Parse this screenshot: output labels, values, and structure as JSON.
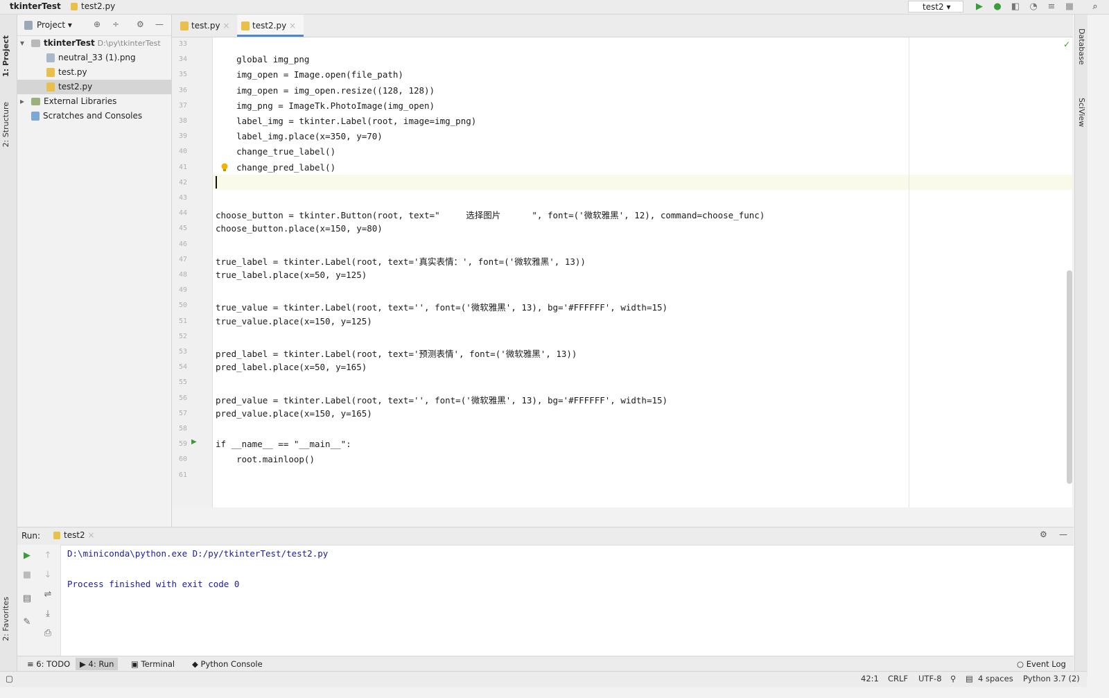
{
  "titlebar": {
    "project": "tkinterTest",
    "file": "test2.py",
    "run_config": "test2"
  },
  "left_strip": {
    "project_tab": "1: Project",
    "structure_tab": "2: Structure",
    "favorites_tab": "2: Favorites"
  },
  "right_strip": {
    "database_tab": "Database",
    "sciview_tab": "SciView"
  },
  "project_panel": {
    "title": "Project",
    "root_name": "tkinterTest",
    "root_path": "D:\\py\\tkinterTest",
    "items": [
      {
        "label": "neutral_33 (1).png"
      },
      {
        "label": "test.py"
      },
      {
        "label": "test2.py"
      },
      {
        "label": "External Libraries"
      },
      {
        "label": "Scratches and Consoles"
      }
    ]
  },
  "editor": {
    "tabs": [
      {
        "label": "test.py"
      },
      {
        "label": "test2.py"
      }
    ],
    "line_numbers": [
      "33",
      "34",
      "35",
      "36",
      "37",
      "38",
      "39",
      "40",
      "41",
      "42",
      "43",
      "44",
      "45",
      "46",
      "47",
      "48",
      "49",
      "50",
      "51",
      "52",
      "53",
      "54",
      "55",
      "56",
      "57",
      "58",
      "59",
      "60",
      "61"
    ],
    "lines": [
      "",
      "    global img_png",
      "    img_open = Image.open(file_path)",
      "    img_open = img_open.resize((128, 128))",
      "    img_png = ImageTk.PhotoImage(img_open)",
      "    label_img = tkinter.Label(root, image=img_png)",
      "    label_img.place(x=350, y=70)",
      "    change_true_label()",
      "    change_pred_label()",
      "",
      "",
      "choose_button = tkinter.Button(root, text=\"     选择图片      \", font=('微软雅黑', 12), command=choose_func)",
      "choose_button.place(x=150, y=80)",
      "",
      "true_label = tkinter.Label(root, text='真实表情：', font=('微软雅黑', 13))",
      "true_label.place(x=50, y=125)",
      "",
      "true_value = tkinter.Label(root, text='', font=('微软雅黑', 13), bg='#FFFFFF', width=15)",
      "true_value.place(x=150, y=125)",
      "",
      "pred_label = tkinter.Label(root, text='预测表情', font=('微软雅黑', 13))",
      "pred_label.place(x=50, y=165)",
      "",
      "pred_value = tkinter.Label(root, text='', font=('微软雅黑', 13), bg='#FFFFFF', width=15)",
      "pred_value.place(x=150, y=165)",
      "",
      "if __name__ == \"__main__\":",
      "    root.mainloop()",
      ""
    ]
  },
  "run_panel": {
    "label": "Run:",
    "tab": "test2",
    "output": [
      "D:\\miniconda\\python.exe D:/py/tkinterTest/test2.py",
      "",
      "Process finished with exit code 0"
    ]
  },
  "bottom_tabs": {
    "todo": "6: TODO",
    "run": "4: Run",
    "terminal": "Terminal",
    "python_console": "Python Console",
    "event_log": "Event Log"
  },
  "status_bar": {
    "position": "42:1",
    "line_sep": "CRLF",
    "encoding": "UTF-8",
    "indent": "4 spaces",
    "interpreter": "Python 3.7 (2)"
  },
  "colors": {
    "accent": "#4a88c7",
    "keyword": "#1a3aa6",
    "string": "#117711",
    "console_text": "#1a1aa6"
  }
}
